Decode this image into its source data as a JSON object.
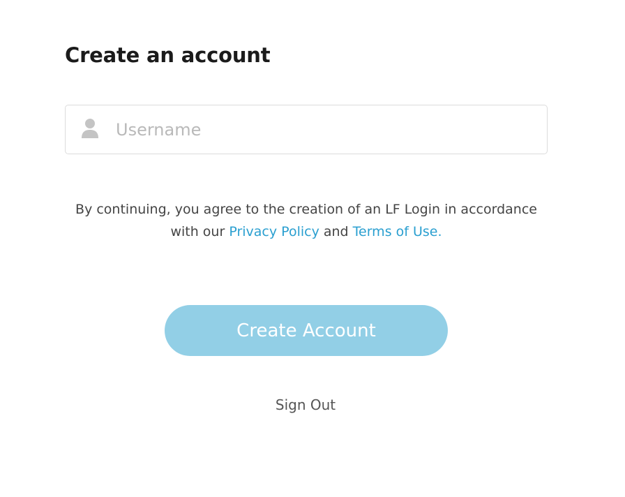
{
  "page": {
    "title": "Create an account"
  },
  "username": {
    "placeholder": "Username",
    "value": "",
    "icon": "user-icon"
  },
  "consent": {
    "text_before": "By continuing, you agree to the creation of an LF Login in accordance with our ",
    "privacy_link": "Privacy Policy",
    "text_middle": " and ",
    "terms_link": "Terms of Use."
  },
  "actions": {
    "create_label": "Create Account",
    "signout_label": "Sign Out"
  },
  "colors": {
    "link": "#2a9fd0",
    "button_bg": "#92cfe6",
    "button_text": "#ffffff",
    "title": "#1b1b1b"
  }
}
